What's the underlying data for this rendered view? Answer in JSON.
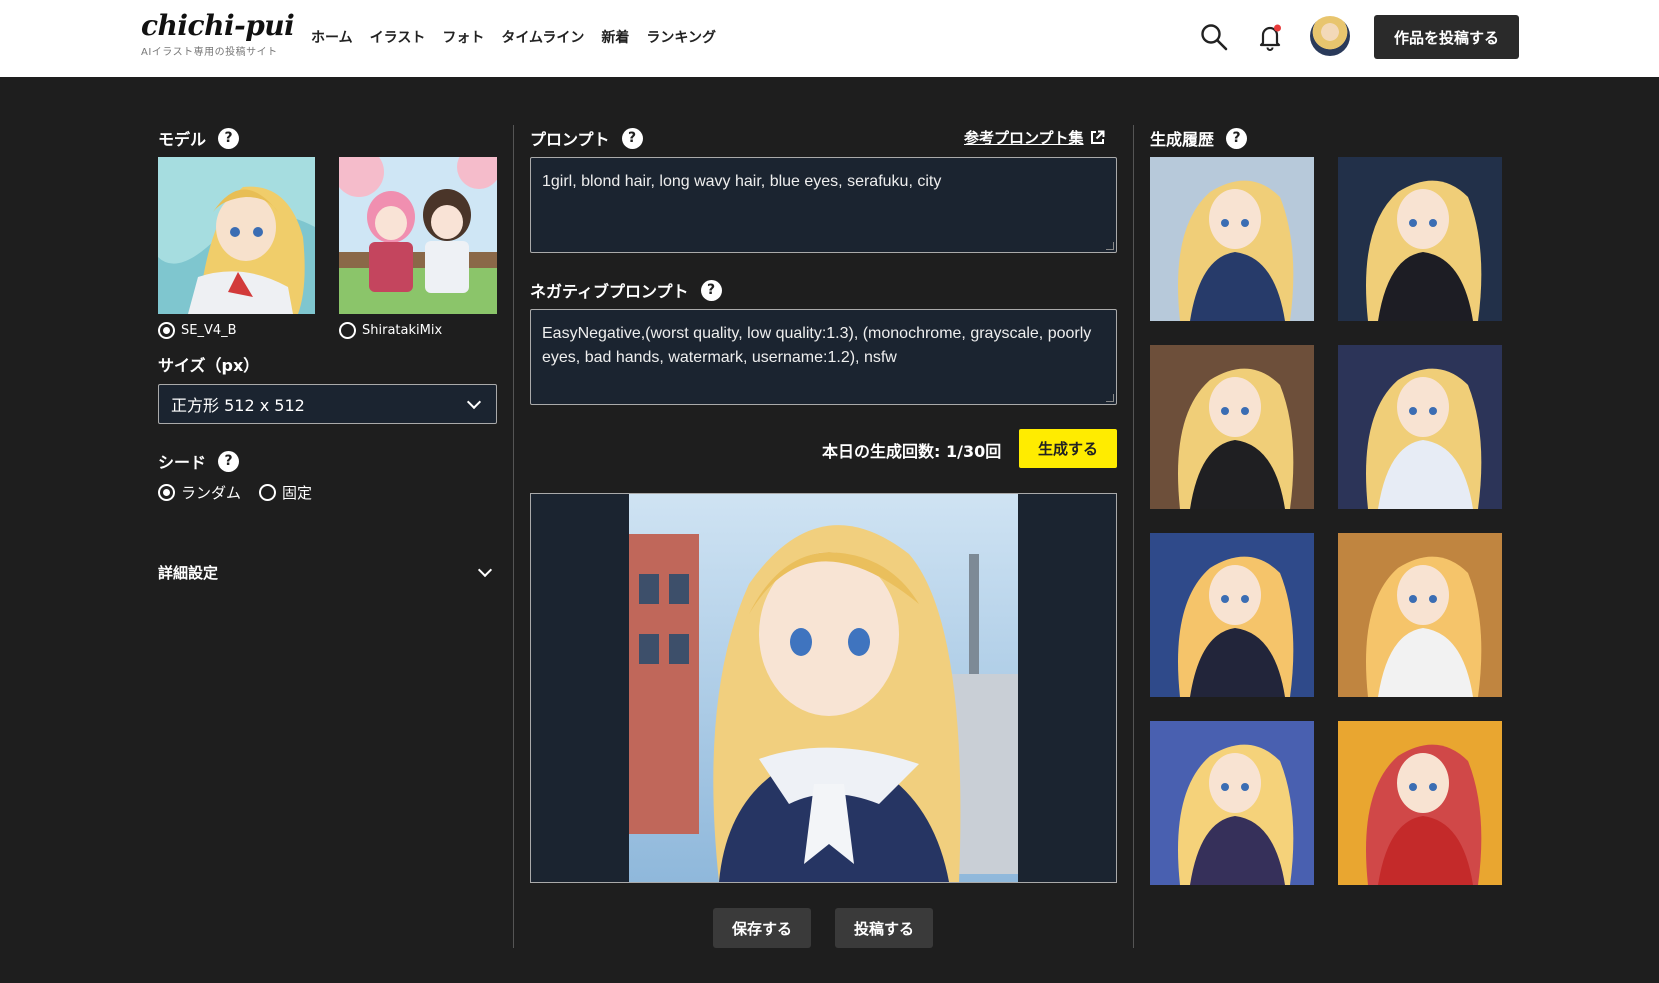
{
  "header": {
    "logo": "chichi-pui",
    "tagline": "AIイラスト専用の投稿サイト",
    "nav": [
      "ホーム",
      "イラスト",
      "フォト",
      "タイムライン",
      "新着",
      "ランキング"
    ],
    "post_button": "作品を投稿する"
  },
  "model": {
    "label": "モデル",
    "options": [
      {
        "name": "SE_V4_B",
        "selected": true
      },
      {
        "name": "ShiratakiMix",
        "selected": false
      }
    ]
  },
  "size": {
    "label": "サイズ（px）",
    "value": "正方形 512 x 512"
  },
  "seed": {
    "label": "シード",
    "options": [
      {
        "name": "ランダム",
        "selected": true
      },
      {
        "name": "固定",
        "selected": false
      }
    ]
  },
  "advanced": {
    "label": "詳細設定"
  },
  "prompt": {
    "label": "プロンプト",
    "reference_link": "参考プロンプト集",
    "value": "1girl, blond hair, long wavy hair, blue eyes, serafuku, city"
  },
  "negative": {
    "label": "ネガティブプロンプト",
    "value": "EasyNegative,(worst quality, low quality:1.3), (monochrome, grayscale, poorly eyes, bad hands, watermark, username:1.2), nsfw"
  },
  "generate": {
    "count_text": "本日の生成回数: 1/30回",
    "button": "生成する"
  },
  "actions": {
    "save": "保存する",
    "post": "投稿する"
  },
  "history": {
    "label": "生成履歴"
  },
  "help_glyph": "?",
  "colors": {
    "accent": "#ffec00",
    "bg": "#1e1e1e",
    "field": "#1b2430"
  }
}
